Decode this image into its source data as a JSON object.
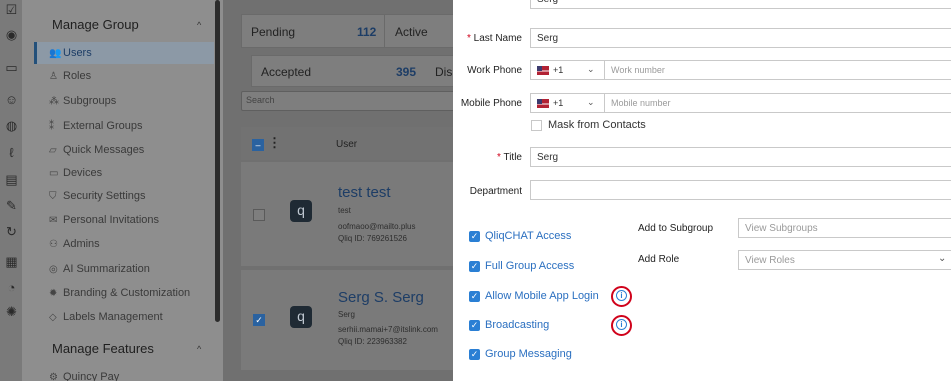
{
  "sidebar": {
    "manage_group": "Manage Group",
    "manage_features": "Manage Features",
    "items": [
      {
        "label": "Users",
        "icon": "users-icon"
      },
      {
        "label": "Roles",
        "icon": "roles-icon"
      },
      {
        "label": "Subgroups",
        "icon": "subgroups-icon"
      },
      {
        "label": "External Groups",
        "icon": "external-groups-icon"
      },
      {
        "label": "Quick Messages",
        "icon": "quick-messages-icon"
      },
      {
        "label": "Devices",
        "icon": "devices-icon"
      },
      {
        "label": "Security Settings",
        "icon": "shield-icon"
      },
      {
        "label": "Personal Invitations",
        "icon": "invitation-icon"
      },
      {
        "label": "Admins",
        "icon": "admins-icon"
      },
      {
        "label": "AI Summarization",
        "icon": "ai-icon"
      },
      {
        "label": "Branding & Customization",
        "icon": "branding-icon"
      },
      {
        "label": "Labels Management",
        "icon": "label-icon"
      }
    ],
    "partial_item": "Quincy Pay"
  },
  "stats": {
    "pending_label": "Pending",
    "pending_count": "112",
    "active_label": "Active",
    "accepted_label": "Accepted",
    "accepted_count": "395",
    "disabled_label": "Dis"
  },
  "search": {
    "placeholder": "Search"
  },
  "table": {
    "user_header": "User"
  },
  "users": [
    {
      "name": "test test",
      "sub": "test",
      "email": "oofmaoo@mailto.plus",
      "qliq_id": "Qliq ID: 769261526",
      "checked": false
    },
    {
      "name": "Serg S. Serg",
      "sub": "Serg",
      "email": "serhii.mamai+7@itslink.com",
      "qliq_id": "Qliq ID: 223963382",
      "checked": true
    }
  ],
  "form": {
    "first_name_partial": "Serg",
    "last_name_label": "Last Name",
    "last_name_value": "Serg",
    "work_phone_label": "Work Phone",
    "work_code": "+1",
    "work_placeholder": "Work number",
    "mobile_phone_label": "Mobile Phone",
    "mobile_code": "+1",
    "mobile_placeholder": "Mobile number",
    "mask_label": "Mask from Contacts",
    "title_label": "Title",
    "title_value": "Serg",
    "department_label": "Department",
    "department_value": "",
    "add_subgroup_label": "Add to Subgroup",
    "subgroup_placeholder": "View Subgroups",
    "add_role_label": "Add Role",
    "role_placeholder": "View Roles",
    "checkboxes": [
      {
        "label": "QliqCHAT Access",
        "checked": true
      },
      {
        "label": "Full Group Access",
        "checked": true
      },
      {
        "label": "Allow Mobile App Login",
        "checked": true
      },
      {
        "label": "Broadcasting",
        "checked": true
      },
      {
        "label": "Group Messaging",
        "checked": true
      }
    ]
  },
  "colors": {
    "accent": "#2a7fd4",
    "highlight": "#d0021b",
    "brand": "#1d3d66"
  }
}
